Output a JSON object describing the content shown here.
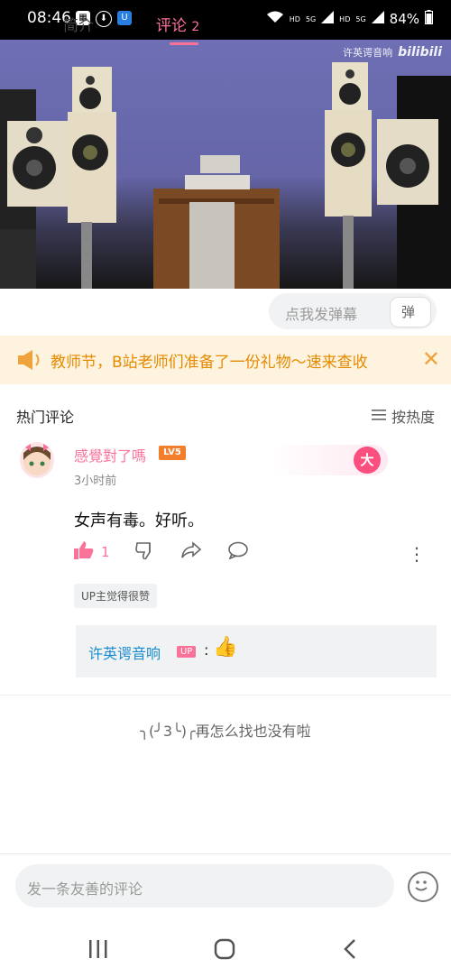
{
  "status_bar": {
    "time": "08:46",
    "battery": "84%",
    "network_hd_1": "HD",
    "network_5g_1": "5G",
    "network_hd_2": "HD",
    "network_5g_2": "5G"
  },
  "video": {
    "watermark_author": "许英谔音响",
    "watermark_logo": "bilibili"
  },
  "tabs": {
    "intro": "简介",
    "comments": "评论",
    "comments_count": "2"
  },
  "danmu": {
    "placeholder": "点我发弹幕",
    "button_label": "弹"
  },
  "banner": {
    "text": "教师节，B站老师们准备了一份礼物～速来查收",
    "close": "✕"
  },
  "comments_header": {
    "title": "热门评论",
    "sort_label": "按热度"
  },
  "comment": {
    "username": "感覺對了嗎",
    "level": "LV5",
    "time": "3小时前",
    "decor_badge": "大",
    "content": "女声有毒。好听。",
    "likes": "1",
    "up_liked": "UP主觉得很赞",
    "reply": {
      "name": "许英谔音响",
      "badge": "UP",
      "colon": ":",
      "emoji": "👍"
    }
  },
  "end_text": "╮(╯3╰)╭再怎么找也没有啦",
  "input": {
    "placeholder": "发一条友善的评论"
  },
  "colors": {
    "accent": "#fb7299",
    "banner_text": "#e68a00",
    "reply_name": "#178bcf"
  }
}
